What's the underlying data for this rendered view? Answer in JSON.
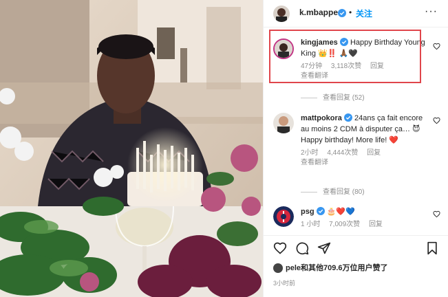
{
  "header": {
    "username": "k.mbappe",
    "dot": "•",
    "follow_label": "关注",
    "more": "···"
  },
  "comments": [
    {
      "username": "kingjames",
      "text": "Happy Birthday Young King 👑‼️ 🙏🏾🖤",
      "time": "47分钟",
      "likes": "3,118次赞",
      "reply": "回复",
      "translate": "查看翻译",
      "replies": "查看回复 (52)"
    },
    {
      "username": "mattpokora",
      "text_line1": "24ans ça fait encore au moins 2 CDM à disputer ça… 😈",
      "text_line2": "Happy birthday! More life! ❤️",
      "time": "2小时",
      "likes": "4,444次赞",
      "reply": "回复",
      "translate": "查看翻译",
      "replies": "查看回复 (80)"
    },
    {
      "username": "psg",
      "text": "🎂❤️💙",
      "time": "1 小时",
      "likes": "7,009次赞",
      "reply": "回复"
    }
  ],
  "likes_summary": {
    "user": "pele",
    "text": "和其他709.6万位用户赞了"
  },
  "post_age": "3小时前",
  "colors": {
    "accent": "#0095f6",
    "verified": "#3897f0",
    "highlight": "#e0454b",
    "heart": "#ed4956"
  }
}
